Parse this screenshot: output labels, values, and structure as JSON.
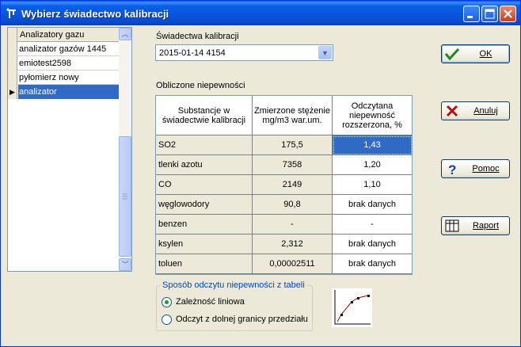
{
  "window": {
    "title": "Wybierz świadectwo kalibracji"
  },
  "list": {
    "header": "Analizatory gazu",
    "items": [
      {
        "label": "analizator gazów 1445",
        "selected": false
      },
      {
        "label": "emiotest2598",
        "selected": false
      },
      {
        "label": "pyłomierz nowy",
        "selected": false
      },
      {
        "label": "analizator",
        "selected": true
      }
    ]
  },
  "certificate": {
    "label": "Świadectwa kalibracji",
    "selected": "2015-01-14 4154"
  },
  "uncertainties": {
    "label": "Obliczone niepewności",
    "columns": [
      "Substancje w świadectwie kalibracji",
      "Zmierzone stężenie mg/m3 war.um.",
      "Odczytana niepewność rozszerzona, %"
    ],
    "rows": [
      [
        "SO2",
        "175,5",
        "1,43"
      ],
      [
        "tlenki azotu",
        "7358",
        "1,20"
      ],
      [
        "CO",
        "2149",
        "1,10"
      ],
      [
        "węglowodory",
        "90,8",
        "brak danych"
      ],
      [
        "benzen",
        "-",
        "-"
      ],
      [
        "ksylen",
        "2,312",
        "brak danych"
      ],
      [
        "toluen",
        "0,00002511",
        "brak danych"
      ]
    ]
  },
  "read_mode": {
    "title": "Sposób odczytu niepewności z tabeli",
    "options": [
      {
        "label": "Zależność liniowa",
        "checked": true
      },
      {
        "label": "Odczyt z dolnej granicy przedziału",
        "checked": false
      }
    ]
  },
  "buttons": {
    "ok": "OK",
    "cancel": "Anuluj",
    "help": "Pomoc",
    "report": "Raport"
  },
  "colors": {
    "selection": "#316ac5",
    "titlebar": "#0754dc",
    "accent_group": "#0046d5"
  },
  "icons": {
    "ok": "checkmark-icon",
    "cancel": "x-icon",
    "help": "question-icon",
    "report": "table-icon"
  }
}
